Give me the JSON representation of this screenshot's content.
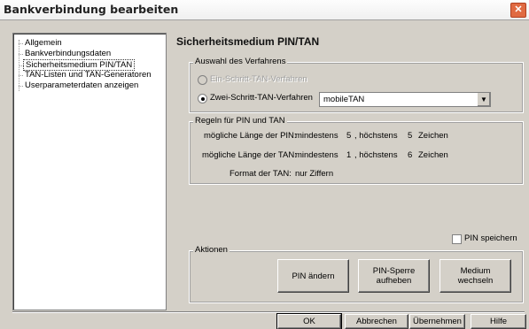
{
  "window": {
    "title": "Bankverbindung bearbeiten",
    "close_icon": "close-icon"
  },
  "tree": {
    "items": [
      {
        "label": "Allgemein",
        "selected": false
      },
      {
        "label": "Bankverbindungsdaten",
        "selected": false
      },
      {
        "label": "Sicherheitsmedium PIN/TAN",
        "selected": true
      },
      {
        "label": "TAN-Listen und TAN-Generatoren",
        "selected": false
      },
      {
        "label": "Userparameterdaten anzeigen",
        "selected": false
      }
    ]
  },
  "page": {
    "heading": "Sicherheitsmedium PIN/TAN"
  },
  "verfahren": {
    "group_label": "Auswahl des Verfahrens",
    "option1": "Ein-Schritt-TAN-Verfahren",
    "option2": "Zwei-Schritt-TAN-Verfahren",
    "selected_option": "Zwei-Schritt-TAN-Verfahren",
    "dropdown_value": "mobileTAN"
  },
  "regeln": {
    "group_label": "Regeln für PIN und TAN",
    "pin_label": "mögliche Länge der PIN:",
    "pin_min_label": "mindestens",
    "pin_min": "5",
    "pin_max_label": ", höchstens",
    "pin_max": "5",
    "pin_unit": "Zeichen",
    "tan_label": "mögliche Länge der TAN:",
    "tan_min_label": "mindestens",
    "tan_min": "1",
    "tan_max_label": ", höchstens",
    "tan_max": "6",
    "tan_unit": "Zeichen",
    "format_label": "Format der TAN:",
    "format_value": "nur Ziffern"
  },
  "pin_speichern": {
    "label": "PIN speichern",
    "checked": false
  },
  "aktionen": {
    "group_label": "Aktionen",
    "pin_aendern": "PIN ändern",
    "pin_sperre": "PIN-Sperre\naufheben",
    "medium": "Medium\nwechseln"
  },
  "footer": {
    "ok": "OK",
    "abbrechen": "Abbrechen",
    "uebernehmen": "Übernehmen",
    "hilfe": "Hilfe"
  }
}
